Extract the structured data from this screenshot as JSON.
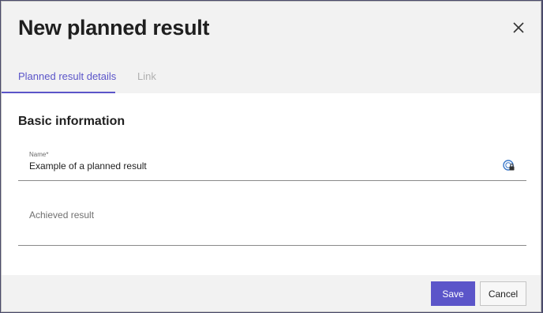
{
  "dialog": {
    "title": "New planned result",
    "close_icon": "close-icon"
  },
  "tabs": [
    {
      "label": "Planned result details",
      "active": true
    },
    {
      "label": "Link",
      "active": false
    }
  ],
  "section": {
    "title": "Basic information"
  },
  "fields": {
    "name": {
      "label": "Name*",
      "value": "Example of a planned result",
      "icon": "password-manager-icon"
    },
    "achieved_result": {
      "placeholder": "Achieved result"
    }
  },
  "footer": {
    "save_label": "Save",
    "cancel_label": "Cancel"
  },
  "colors": {
    "accent": "#5b55c9",
    "header_bg": "#f2f2f2",
    "content_bg": "#ffffff"
  }
}
